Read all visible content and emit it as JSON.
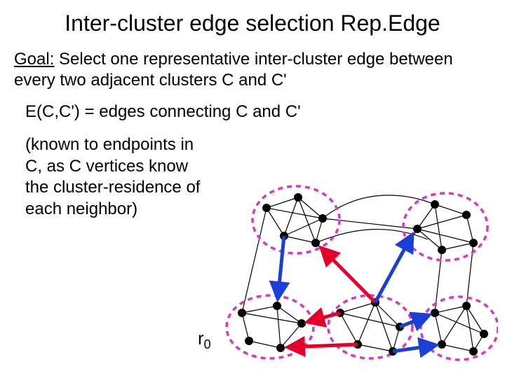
{
  "title": "Inter-cluster edge selection Rep.Edge",
  "goal_label": "Goal:",
  "goal_text": " Select one representative inter-cluster edge between every two adjacent clusters C and C'",
  "ecc": "E(C,C') = edges connecting C and C'",
  "known": "(known to endpoints in C, as C vertices know the cluster-residence of each neighbor)",
  "r0": "r",
  "r0_sub": "0"
}
